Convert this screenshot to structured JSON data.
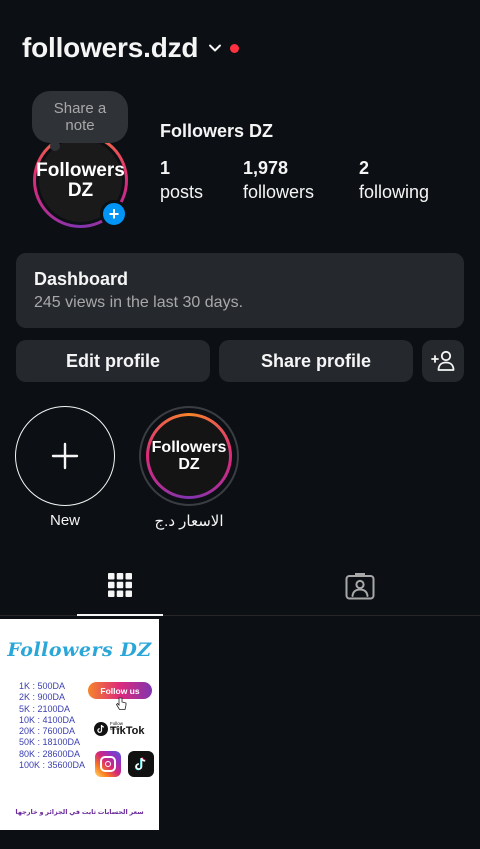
{
  "header": {
    "username": "followers.dzd",
    "chevron_icon": "chevron-down-icon",
    "notification_dot_color": "#ff3040"
  },
  "note": {
    "text": "Share a note"
  },
  "profile": {
    "avatar_line1": "Followers",
    "avatar_line2": "DZ",
    "add_story_icon": "plus-icon",
    "display_name": "Followers DZ",
    "stats": {
      "posts": {
        "value": "1",
        "label": "posts"
      },
      "followers": {
        "value": "1,978",
        "label": "followers"
      },
      "following": {
        "value": "2",
        "label": "following"
      }
    }
  },
  "dashboard": {
    "title": "Dashboard",
    "subtitle": "245 views in the last 30 days."
  },
  "actions": {
    "edit_label": "Edit profile",
    "share_label": "Share profile",
    "discover_icon": "add-person-icon"
  },
  "highlights": [
    {
      "label": "New",
      "icon": "plus-icon"
    },
    {
      "label": "الاسعار د.ج",
      "cover_line1": "Followers",
      "cover_line2": "DZ"
    }
  ],
  "tabs": [
    {
      "icon": "grid-icon",
      "active": true
    },
    {
      "icon": "tagged-person-icon",
      "active": false
    }
  ],
  "posts": [
    {
      "title": "Followers DZ",
      "prices": [
        "1K : 500DA",
        "2K : 900DA",
        "5K : 2100DA",
        "10K : 4100DA",
        "20K : 7600DA",
        "50K : 18100DA",
        "80K : 28600DA",
        "100K : 35600DA"
      ],
      "follow_button": "Follow us",
      "tiktok_small": "Follow us on",
      "tiktok_label": "TikTok",
      "footer": "سعر الحسابات ثابت في الجزائر و خارجها"
    }
  ],
  "colors": {
    "background": "#0c1014",
    "card": "#25292e",
    "accent_blue": "#0095f6",
    "muted_text": "#a8a8a8"
  }
}
